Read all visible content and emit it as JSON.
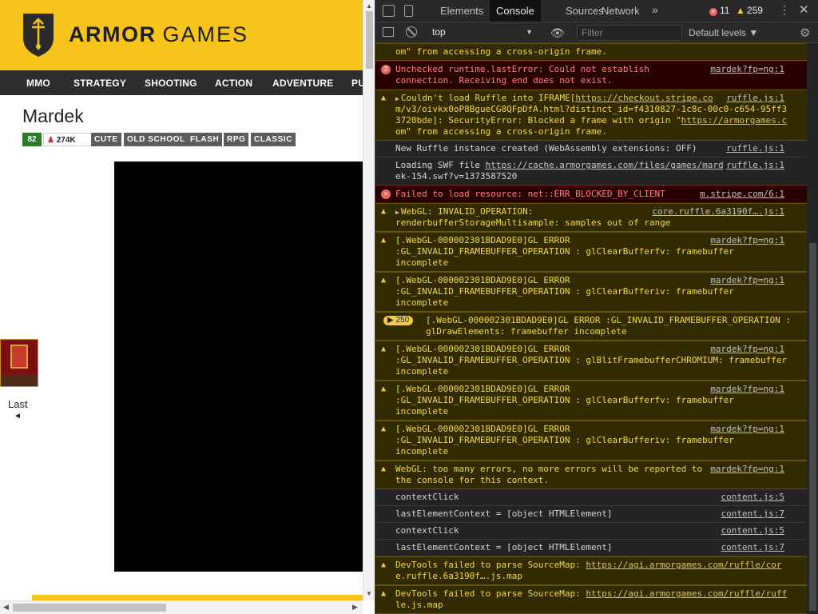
{
  "site": {
    "logo_text_bold": "ARMOR",
    "logo_text_thin": "GAMES",
    "nav": [
      "MMO",
      "STRATEGY",
      "SHOOTING",
      "ACTION",
      "ADVENTURE",
      "PU"
    ],
    "game_title": "Mardek",
    "rating": "82",
    "plays": "274K",
    "tags": [
      "CUTE",
      "OLD SCHOOL",
      "FLASH",
      "RPG",
      "CLASSIC"
    ],
    "last_label": "Last",
    "last_arrow": "◄"
  },
  "devtools": {
    "tabs": [
      "Elements",
      "Console",
      "Sources",
      "Network"
    ],
    "active_tab": "Console",
    "more_tabs": "»",
    "error_count": "11",
    "warning_count": "259",
    "context": "top",
    "filter_placeholder": "Filter",
    "levels": "Default levels ▼",
    "prompt": "›",
    "messages": [
      {
        "level": "warn",
        "lines": [
          "om\" from accessing a cross-origin frame."
        ],
        "source": ""
      },
      {
        "level": "error",
        "icon": "2",
        "lines": [
          "Unchecked runtime.lastError: Could not establish",
          "connection. Receiving end does not exist."
        ],
        "source": "mardek?fp=ng:1"
      },
      {
        "level": "warn",
        "expand": true,
        "lines": [
          "Couldn't load Ruffle into IFRAME[https://checkout.stripe.co",
          "m/v3/oivkx0oP8BgueCG8QFpDfA.html?distinct_id=f4310827-1c8c-00c0-c654-95ff3",
          "3720bde]: SecurityError: Blocked a frame with origin \"https://armorgames.c",
          "om\" from accessing a cross-origin frame."
        ],
        "source": "ruffle.js:1"
      },
      {
        "level": "log",
        "lines": [
          "New Ruffle instance created (WebAssembly extensions: OFF)"
        ],
        "source": "ruffle.js:1"
      },
      {
        "level": "log",
        "lines": [
          "Loading SWF file https://cache.armorgames.com/files/games/mard",
          "ek-154.swf?v=1373587520"
        ],
        "source": "ruffle.js:1"
      },
      {
        "level": "error",
        "lines": [
          "Failed to load resource: net::ERR_BLOCKED_BY_CLIENT"
        ],
        "source": "m.stripe.com/6:1"
      },
      {
        "level": "warn",
        "expand": true,
        "lines": [
          "WebGL: INVALID_OPERATION:",
          "renderbufferStorageMultisample: samples out of range"
        ],
        "source": "core.ruffle.6a3190f….js:1"
      },
      {
        "level": "warn",
        "lines": [
          "[.WebGL-000002301BDAD9E0]GL ERROR",
          ":GL_INVALID_FRAMEBUFFER_OPERATION : glClearBufferfv: framebuffer",
          "incomplete"
        ],
        "source": "mardek?fp=ng:1"
      },
      {
        "level": "warn",
        "lines": [
          "[.WebGL-000002301BDAD9E0]GL ERROR",
          ":GL_INVALID_FRAMEBUFFER_OPERATION : glClearBufferiv: framebuffer",
          "incomplete"
        ],
        "source": "mardek?fp=ng:1"
      },
      {
        "level": "warn",
        "repeat": "250",
        "lines": [
          "[.WebGL-000002301BDAD9E0]GL ERROR :GL_INVALID_FRAMEBUFFER_OPERATION :",
          "glDrawElements: framebuffer incomplete"
        ],
        "source": ""
      },
      {
        "level": "warn",
        "lines": [
          "[.WebGL-000002301BDAD9E0]GL ERROR",
          ":GL_INVALID_FRAMEBUFFER_OPERATION : glBlitFramebufferCHROMIUM: framebuffer",
          "incomplete"
        ],
        "source": "mardek?fp=ng:1"
      },
      {
        "level": "warn",
        "lines": [
          "[.WebGL-000002301BDAD9E0]GL ERROR",
          ":GL_INVALID_FRAMEBUFFER_OPERATION : glClearBufferfv: framebuffer",
          "incomplete"
        ],
        "source": "mardek?fp=ng:1"
      },
      {
        "level": "warn",
        "lines": [
          "[.WebGL-000002301BDAD9E0]GL ERROR",
          ":GL_INVALID_FRAMEBUFFER_OPERATION : glClearBufferiv: framebuffer",
          "incomplete"
        ],
        "source": "mardek?fp=ng:1"
      },
      {
        "level": "warn",
        "lines": [
          "WebGL: too many errors, no more errors will be reported to",
          "the console for this context."
        ],
        "source": "mardek?fp=ng:1"
      },
      {
        "level": "log",
        "lines": [
          "contextClick"
        ],
        "source": "content.js:5"
      },
      {
        "level": "log",
        "lines": [
          "lastElementContext = [object HTMLElement]"
        ],
        "source": "content.js:7"
      },
      {
        "level": "log",
        "lines": [
          "contextClick"
        ],
        "source": "content.js:5"
      },
      {
        "level": "log",
        "lines": [
          "lastElementContext = [object HTMLElement]"
        ],
        "source": "content.js:7"
      },
      {
        "level": "warn",
        "lines": [
          "DevTools failed to parse SourceMap: https://agi.armorgames.com/ruffle/cor",
          "e.ruffle.6a3190f….js.map"
        ],
        "source": ""
      },
      {
        "level": "warn",
        "lines": [
          "DevTools failed to parse SourceMap: https://agi.armorgames.com/ruffle/ruff",
          "le.js.map"
        ],
        "source": ""
      }
    ]
  }
}
